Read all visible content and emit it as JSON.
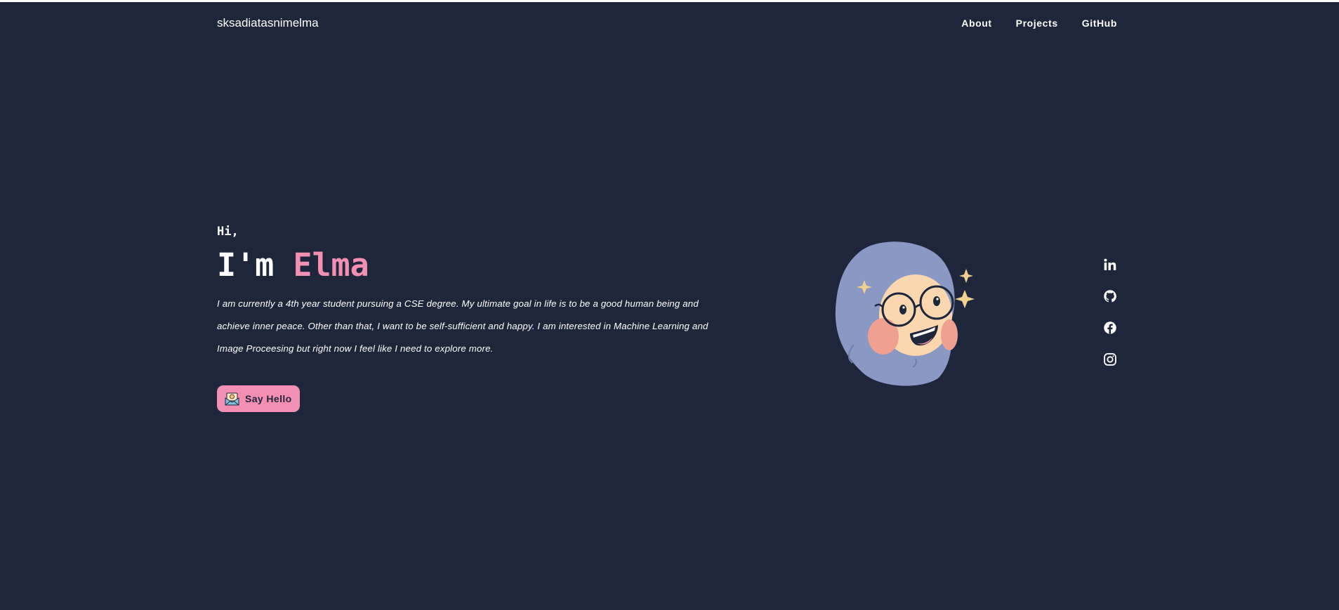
{
  "header": {
    "brand": "sksadiatasnimelma",
    "nav": [
      {
        "label": "About"
      },
      {
        "label": "Projects"
      },
      {
        "label": "GitHub"
      }
    ]
  },
  "hero": {
    "greeting": "Hi,",
    "headline_prefix": "I'm ",
    "name": "Elma",
    "bio": "I am currently a 4th year student pursuing a CSE degree. My ultimate goal in life is to be a good human being and achieve inner peace. Other than that, I want to be self-sufficient and happy. I am interested in Machine Learning and Image Proceesing but right now I feel like I need to explore more.",
    "cta_label": "Say Hello",
    "cta_icon": "envelope-heart-icon"
  },
  "avatar": {
    "icon": "girl-with-glasses-illustration"
  },
  "socials": [
    {
      "icon": "linkedin-icon"
    },
    {
      "icon": "github-icon"
    },
    {
      "icon": "facebook-icon"
    },
    {
      "icon": "instagram-icon"
    }
  ],
  "colors": {
    "background": "#1e263b",
    "accent": "#f28fb3",
    "text": "#ffffff",
    "hair": "#8a99c4",
    "skin": "#fbd7b0",
    "blush": "#f0a091",
    "sparkle": "#f3d08d"
  }
}
